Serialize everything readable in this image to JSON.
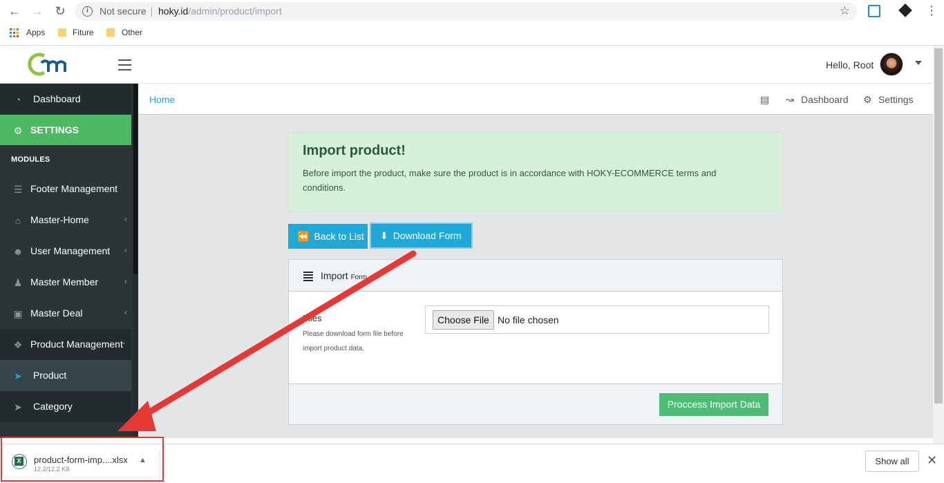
{
  "browser": {
    "security": "Not secure",
    "url_host": "hoky.id",
    "url_path": "/admin/product/import",
    "bookmarks": [
      "Apps",
      "Fiture",
      "Other"
    ]
  },
  "header": {
    "greeting": "Hello, Root"
  },
  "sidebar": {
    "items": [
      {
        "label": "Dashboard",
        "icon": "gauge-icon"
      },
      {
        "label": "SETTINGS",
        "icon": "gear-icon"
      },
      {
        "label": "Footer Management",
        "icon": "list-icon"
      },
      {
        "label": "Master-Home",
        "icon": "home-icon"
      },
      {
        "label": "User Management",
        "icon": "user-icon"
      },
      {
        "label": "Master Member",
        "icon": "users-icon"
      },
      {
        "label": "Master Deal",
        "icon": "deal-icon"
      },
      {
        "label": "Product Management",
        "icon": "cubes-icon"
      },
      {
        "label": "Product",
        "icon": "send-icon"
      },
      {
        "label": "Category",
        "icon": "send-icon"
      }
    ],
    "section_title": "MODULES"
  },
  "breadcrumb": {
    "home": "Home",
    "right": {
      "dashboard": "Dashboard",
      "settings": "Settings"
    }
  },
  "alert": {
    "title": "Import product!",
    "body": "Before import the product, make sure the product is in accordance with HOKY-ECOMMERCE terms and conditions."
  },
  "buttons": {
    "back": "Back to List",
    "download": "Download Form",
    "process": "Proccess Import Data"
  },
  "form": {
    "title": "Import",
    "title_small": "Form",
    "files_label": "Files",
    "help": "Please download form file before import product data.",
    "choose": "Choose File",
    "no_file": "No file chosen"
  },
  "download_bar": {
    "file_name": "product-form-imp....xlsx",
    "file_size": "12.2/12.2 KB",
    "show_all": "Show all"
  },
  "colors": {
    "accent": "#20a8d8",
    "success": "#4dbd74",
    "sidebar": "#2b3437",
    "annotation": "#e53935"
  }
}
